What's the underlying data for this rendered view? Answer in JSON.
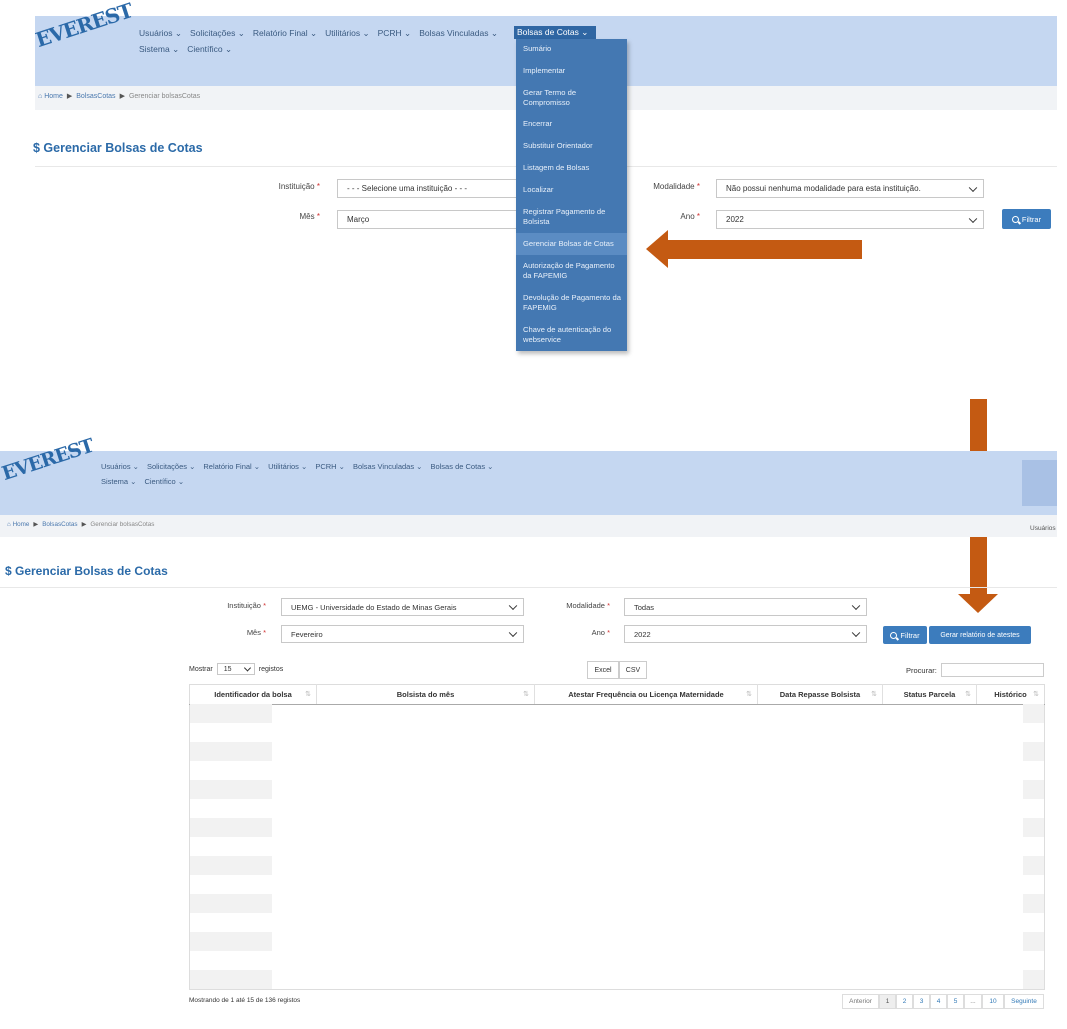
{
  "logo_text": "EVEREST",
  "top": {
    "nav_row1": [
      "Usuários ⌄",
      "Solicitações ⌄",
      "Relatório Final ⌄",
      "Utilitários ⌄",
      "PCRH ⌄",
      "Bolsas Vinculadas ⌄"
    ],
    "nav_active": "Bolsas de Cotas ⌄",
    "nav_row2": [
      "Sistema ⌄",
      "Científico ⌄"
    ],
    "breadcrumb": {
      "home": "Home",
      "level1": "BolsasCotas",
      "current": "Gerenciar bolsasCotas"
    },
    "page_title": "$ Gerenciar Bolsas de Cotas",
    "form": {
      "instituicao_label": "Instituição",
      "instituicao_value": "- - - Selecione uma instituição - - -",
      "modalidade_label": "Modalidade",
      "modalidade_value": "Não possui nenhuma modalidade para esta instituição.",
      "mes_label": "Mês",
      "mes_value": "Março",
      "ano_label": "Ano",
      "ano_value": "2022",
      "required_mark": "*",
      "filter_button": "Filtrar"
    },
    "dropdown": [
      "Sumário",
      "Implementar",
      "Gerar Termo de Compromisso",
      "Encerrar",
      "Substituir Orientador",
      "Listagem de Bolsas",
      "Localizar",
      "Registrar Pagamento de Bolsista",
      "Gerenciar Bolsas de Cotas",
      "Autorização de Pagamento da FAPEMIG",
      "Devolução de Pagamento da FAPEMIG",
      "Chave de autenticação do webservice"
    ]
  },
  "bottom": {
    "nav_row1": [
      "Usuários ⌄",
      "Solicitações ⌄",
      "Relatório Final ⌄",
      "Utilitários ⌄",
      "PCRH ⌄",
      "Bolsas Vinculadas ⌄",
      "Bolsas de Cotas ⌄"
    ],
    "nav_row2": [
      "Sistema ⌄",
      "Científico ⌄"
    ],
    "breadcrumb": {
      "home": "Home",
      "level1": "BolsasCotas",
      "current": "Gerenciar bolsasCotas"
    },
    "user_label": "Usuários",
    "page_title": "$ Gerenciar Bolsas de Cotas",
    "form": {
      "instituicao_label": "Instituição",
      "instituicao_value": "UEMG - Universidade do Estado de Minas Gerais",
      "modalidade_label": "Modalidade",
      "modalidade_value": "Todas",
      "mes_label": "Mês",
      "mes_value": "Fevereiro",
      "ano_label": "Ano",
      "ano_value": "2022",
      "required_mark": "*",
      "filter_button": "Filtrar",
      "report_button": "Gerar relatório de atestes"
    },
    "table_controls": {
      "show_prefix": "Mostrar",
      "show_value": "15",
      "show_suffix": "registos",
      "excel": "Excel",
      "csv": "CSV",
      "search_label": "Procurar:"
    },
    "columns": [
      "Identificador da bolsa",
      "Bolsista do mês",
      "Atestar Frequência ou Licença Maternidade",
      "Data Repasse Bolsista",
      "Status Parcela",
      "Histórico"
    ],
    "footer_info": "Mostrando de 1 até 15 de 136 registos",
    "pagination": [
      "Anterior",
      "1",
      "2",
      "3",
      "4",
      "5",
      "...",
      "10",
      "Seguinte"
    ]
  }
}
